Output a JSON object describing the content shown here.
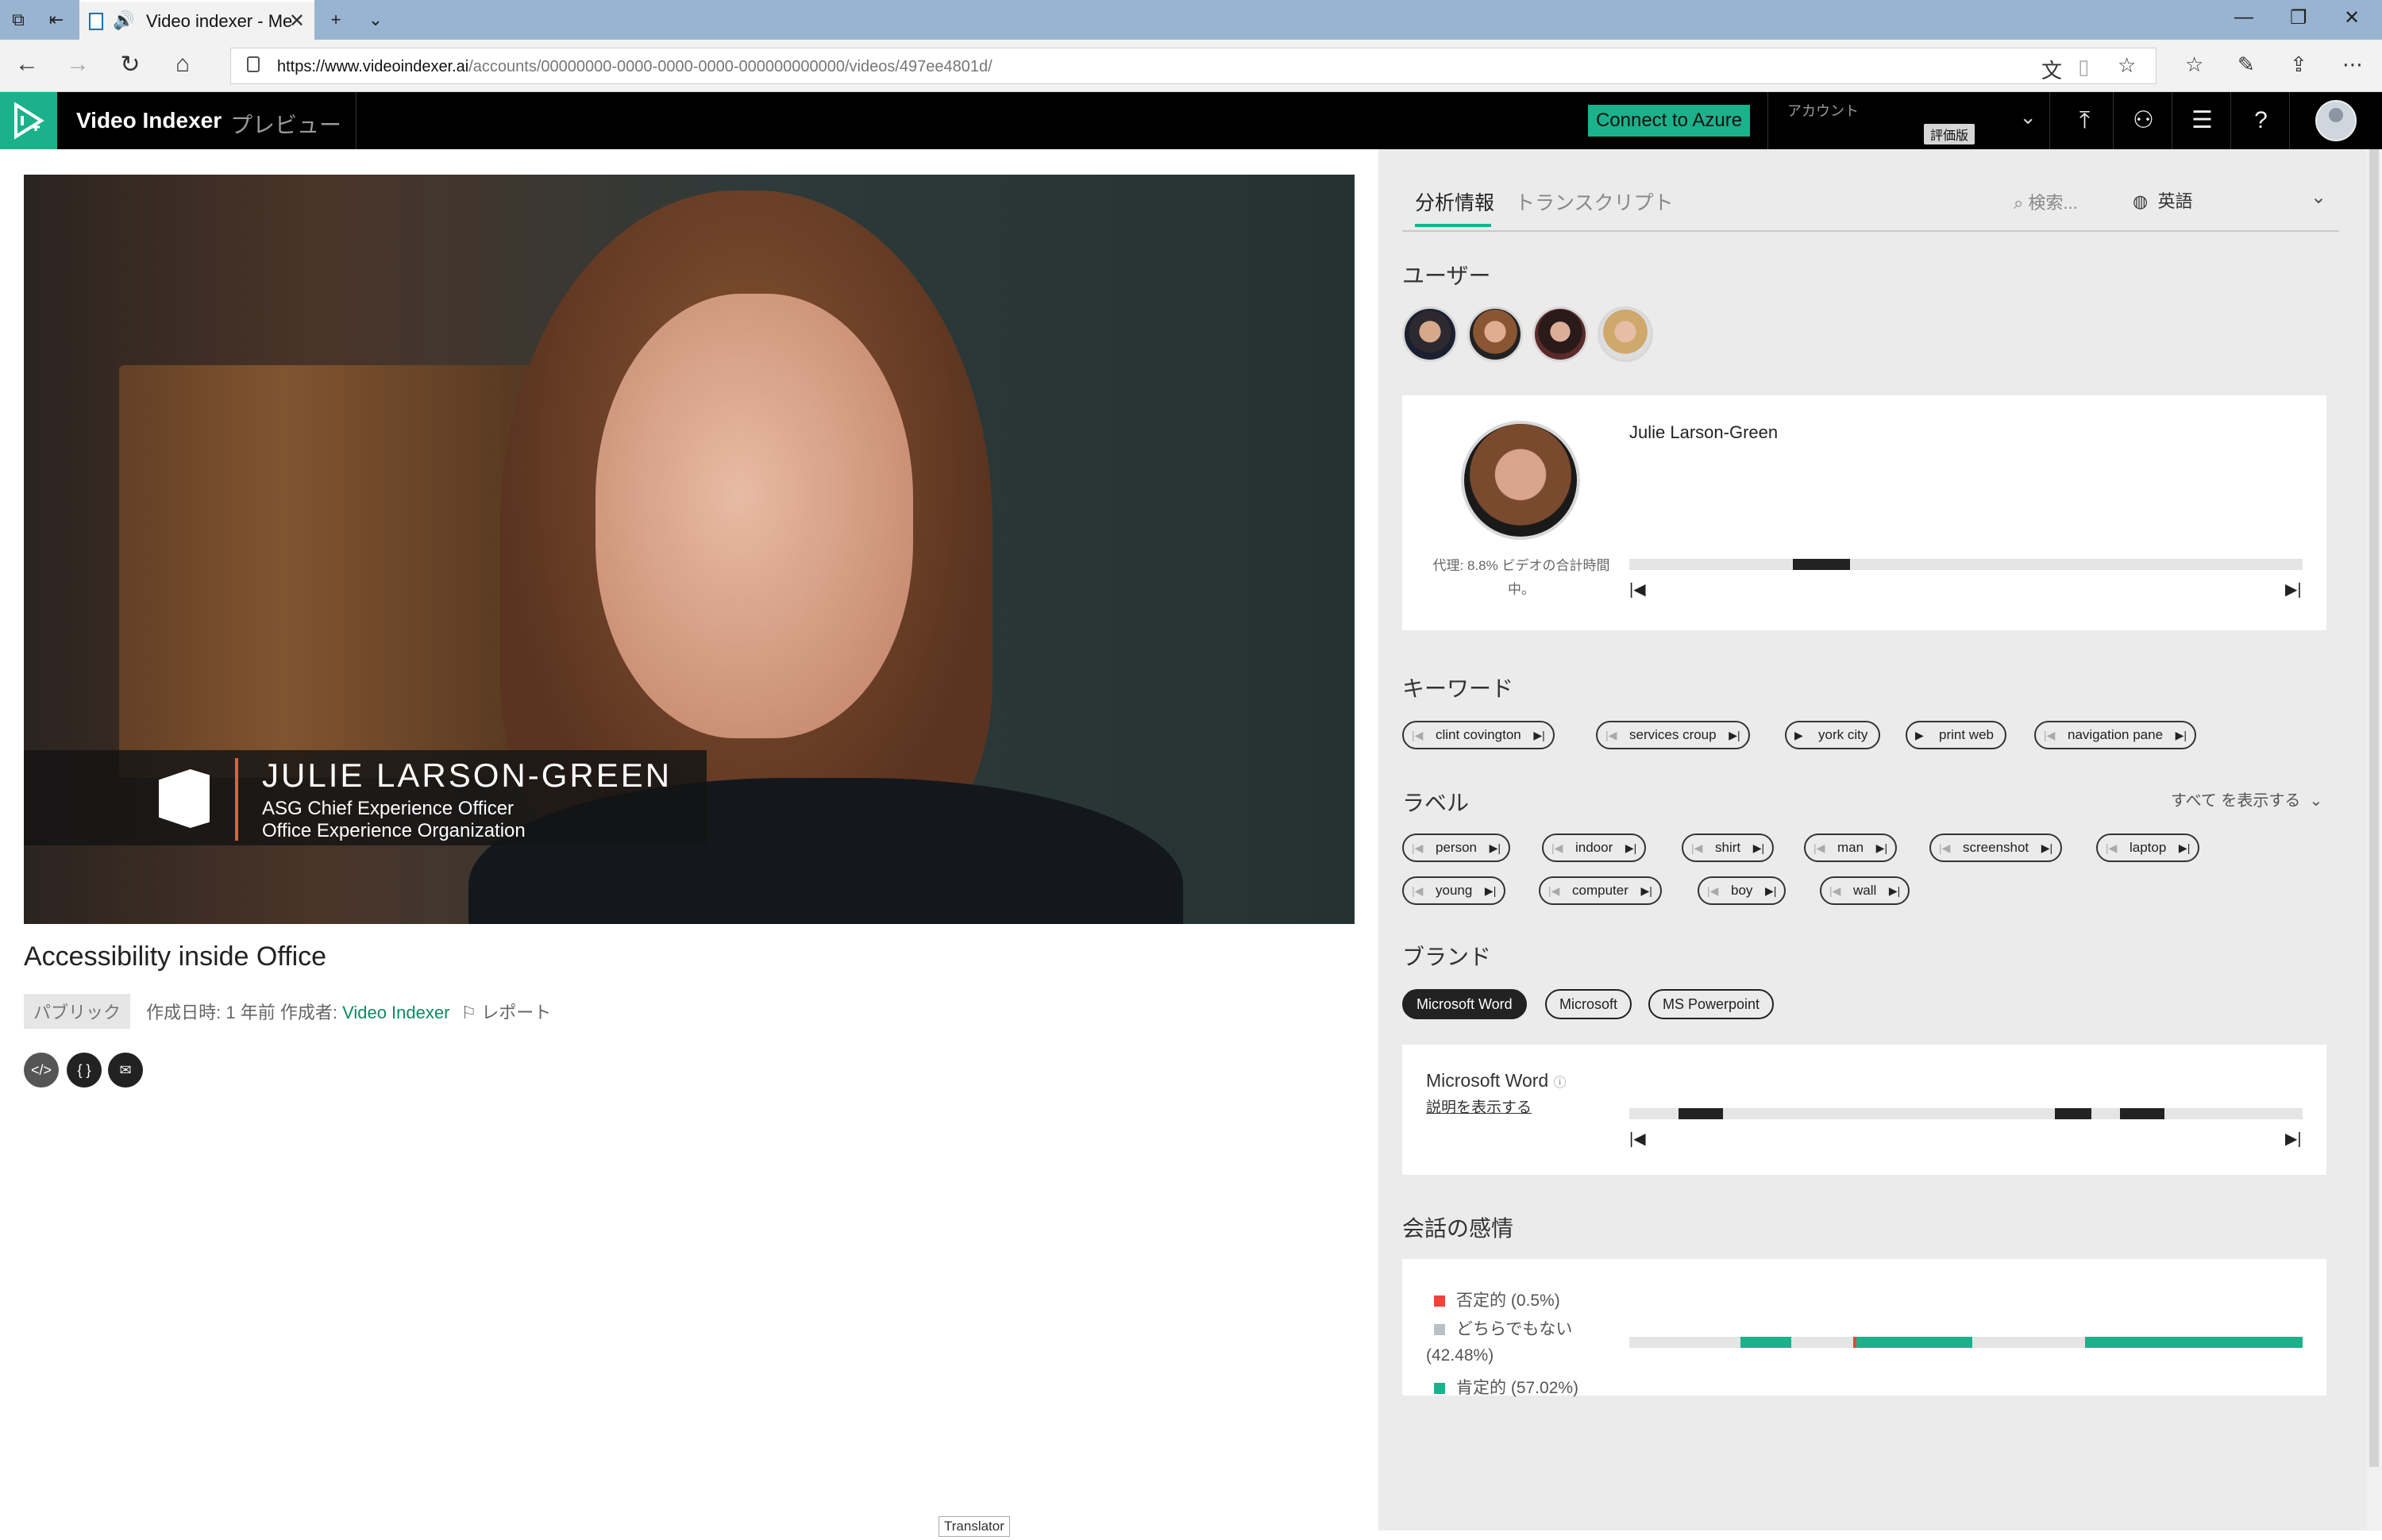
{
  "browser": {
    "tab_title": "Video indexer - Me",
    "url_host": "https://www.videoindexer.ai",
    "url_path": "/accounts/00000000-0000-0000-0000-000000000000/videos/497ee4801d/"
  },
  "app": {
    "name": "Video Indexer",
    "preview": "プレビュー",
    "connect_azure": "Connect to Azure",
    "account_label": "アカウント",
    "trial_badge": "評価版",
    "accent": "#1bb28b"
  },
  "video": {
    "lower_third_name": "JULIE LARSON-GREEN",
    "lower_third_title1": "ASG Chief Experience Officer",
    "lower_third_title2": "Office Experience Organization",
    "title": "Accessibility inside Office",
    "visibility": "パブリック",
    "meta_prefix": "作成日時: 1 年前 作成者: ",
    "author": "Video Indexer",
    "report": "レポート",
    "translator": "Translator"
  },
  "insights": {
    "tab_insights": "分析情報",
    "tab_transcript": "トランスクリプト",
    "search_placeholder": "検索...",
    "language": "英語",
    "people_title": "ユーザー",
    "selected_person": {
      "name": "Julie Larson-Green",
      "caption1": "代理: 8.8% ビデオの合計時間",
      "caption2": "中。",
      "appearance_fraction": 0.088
    },
    "keywords_title": "キーワード",
    "keywords": [
      "clint covington",
      "services croup",
      "york city",
      "print web",
      "navigation pane"
    ],
    "labels_title": "ラベル",
    "show_all": "すべて を表示する",
    "labels_row1": [
      "person",
      "indoor",
      "shirt",
      "man",
      "screenshot",
      "laptop"
    ],
    "labels_row2": [
      "young",
      "computer",
      "boy",
      "wall"
    ],
    "brands_title": "ブランド",
    "brands": [
      "Microsoft Word",
      "Microsoft",
      "MS Powerpoint"
    ],
    "brand_detail": {
      "name": "Microsoft Word",
      "show_description": "説明を表示する"
    },
    "sentiment_title": "会話の感情",
    "sentiment": {
      "negative": "否定的 (0.5%)",
      "neutral_a": "どちらでもない",
      "neutral_b": "(42.48%)",
      "positive": "肯定的 (57.02%)",
      "colors": {
        "negative": "#e8463a",
        "neutral": "#b9c0c6",
        "positive": "#1bb28b"
      }
    }
  }
}
